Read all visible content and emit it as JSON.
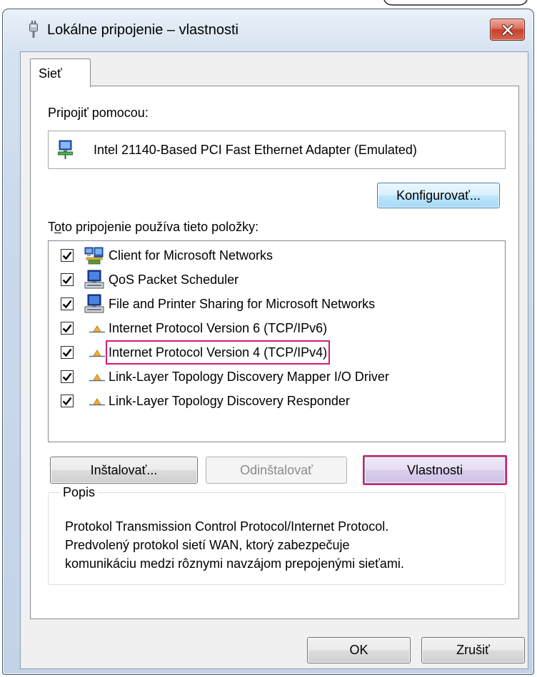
{
  "window": {
    "title": "Lokálne pripojenie – vlastnosti",
    "title_icon": "network-plug-icon",
    "close_icon": "close-icon"
  },
  "tabs": [
    {
      "label": "Sieť",
      "selected": true
    }
  ],
  "network_tab": {
    "connect_using_label": "Pripojiť pomocou:",
    "adapter": {
      "icon": "network-adapter-icon",
      "name": "Intel 21140-Based PCI Fast Ethernet Adapter (Emulated)"
    },
    "configure_button": "Konfigurovať...",
    "items_label": {
      "before_access_key": "T",
      "access_key": "o",
      "after_access_key": "to pripojenie používa tieto položky:"
    },
    "items": [
      {
        "label": "Client for Microsoft Networks",
        "checked": true,
        "icon": "network-client-icon",
        "highlighted": false
      },
      {
        "label": "QoS Packet Scheduler",
        "checked": true,
        "icon": "computer-icon",
        "highlighted": false
      },
      {
        "label": "File and Printer Sharing for Microsoft Networks",
        "checked": true,
        "icon": "computer-icon",
        "highlighted": false
      },
      {
        "label": "Internet Protocol Version 6 (TCP/IPv6)",
        "checked": true,
        "icon": "protocol-icon",
        "highlighted": false
      },
      {
        "label": "Internet Protocol Version 4 (TCP/IPv4)",
        "checked": true,
        "icon": "protocol-icon",
        "highlighted": true
      },
      {
        "label": "Link-Layer Topology Discovery Mapper I/O Driver",
        "checked": true,
        "icon": "protocol-icon",
        "highlighted": false
      },
      {
        "label": "Link-Layer Topology Discovery Responder",
        "checked": true,
        "icon": "protocol-icon",
        "highlighted": false
      }
    ],
    "buttons": {
      "install": {
        "label": "Inštalovať...",
        "enabled": true
      },
      "uninstall": {
        "label": "Odinštalovať",
        "enabled": false
      },
      "properties": {
        "label": "Vlastnosti",
        "enabled": true,
        "highlighted": true
      }
    },
    "description": {
      "legend": "Popis",
      "lines": [
        "Protokol Transmission Control Protocol/Internet Protocol.",
        "Predvolený protokol sietí WAN, ktorý zabezpečuje",
        "komunikáciu medzi rôznymi navzájom prepojenými sieťami."
      ]
    }
  },
  "footer": {
    "ok_button": "OK",
    "cancel_button": "Zrušiť"
  },
  "colors": {
    "highlight_outline": "#d81b72",
    "dialog_face": "#f0f0f0",
    "window_frame": "#c9d8ea",
    "close_button": "#c8412d"
  }
}
